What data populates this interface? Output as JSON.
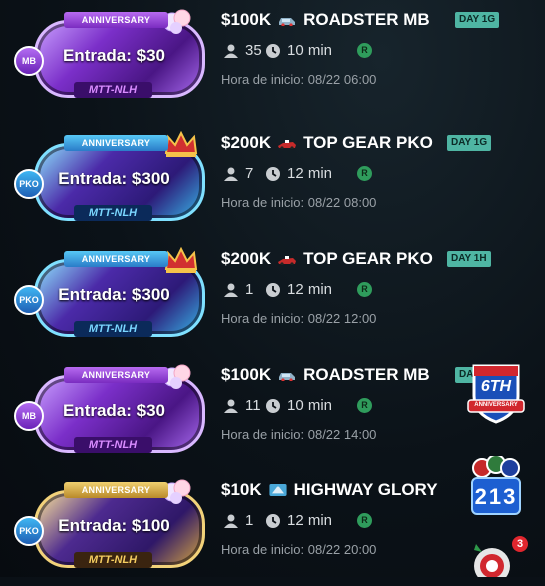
{
  "start_label": "Hora de inicio:",
  "colors": {
    "day_badge": "#4fb5a3",
    "r_badge": "#2f9c5c",
    "background": "#0a1016"
  },
  "tournaments": [
    {
      "theme": "purple",
      "ribbon": "ANNIVERSARY",
      "type_badge": "MB",
      "entry": "Entrada: $30",
      "subtag": "MTT-NLH",
      "prize": "$100K",
      "name": "ROADSTER MB",
      "icon": "car-icon",
      "day_tag": "DAY 1G",
      "players": "35",
      "duration": "10 min",
      "r_badge": "R",
      "start_time": "08/22 06:00"
    },
    {
      "theme": "blue",
      "ribbon": "ANNIVERSARY",
      "type_badge": "PKO",
      "entry": "Entrada: $300",
      "subtag": "MTT-NLH",
      "prize": "$200K",
      "name": "TOP GEAR PKO",
      "icon": "race-car-icon",
      "day_tag": "DAY 1G",
      "players": "7",
      "duration": "12 min",
      "r_badge": "R",
      "start_time": "08/22 08:00"
    },
    {
      "theme": "blue",
      "ribbon": "ANNIVERSARY",
      "type_badge": "PKO",
      "entry": "Entrada: $300",
      "subtag": "MTT-NLH",
      "prize": "$200K",
      "name": "TOP GEAR PKO",
      "icon": "race-car-icon",
      "day_tag": "DAY 1H",
      "players": "1",
      "duration": "12 min",
      "r_badge": "R",
      "start_time": "08/22 12:00"
    },
    {
      "theme": "purple",
      "ribbon": "ANNIVERSARY",
      "type_badge": "MB",
      "entry": "Entrada: $30",
      "subtag": "MTT-NLH",
      "prize": "$100K",
      "name": "ROADSTER MB",
      "icon": "car-icon",
      "day_tag": "DA",
      "players": "11",
      "duration": "10 min",
      "r_badge": "R",
      "start_time": "08/22 14:00"
    },
    {
      "theme": "gold",
      "ribbon": "ANNIVERSARY",
      "type_badge": "PKO",
      "entry": "Entrada: $100",
      "subtag": "MTT-NLH",
      "prize": "$10K",
      "name": "HIGHWAY GLORY",
      "icon": "highway-sign-icon",
      "day_tag": "",
      "players": "1",
      "duration": "12 min",
      "r_badge": "R",
      "start_time": "08/22 20:00"
    }
  ],
  "side_widgets": {
    "anniversary_shield": {
      "number": "6TH",
      "label": "ANNIVERSARY"
    },
    "lucky_number": {
      "digits": "213"
    },
    "notification_count": "3"
  }
}
